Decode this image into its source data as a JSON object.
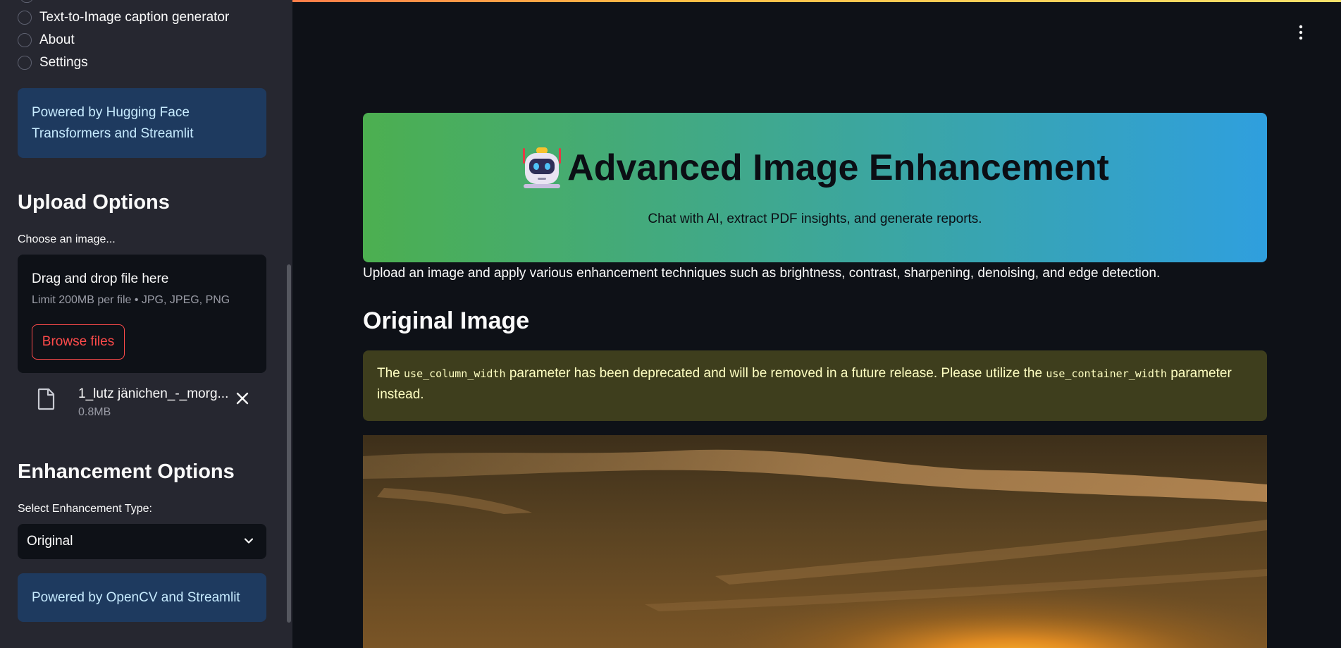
{
  "sidebar": {
    "nav": {
      "items": [
        "Text-to-Image caption generator",
        "About",
        "Settings"
      ]
    },
    "info_top": "Powered by Hugging Face Transformers and Streamlit",
    "upload": {
      "heading": "Upload Options",
      "label": "Choose an image...",
      "drop_title": "Drag and drop file here",
      "drop_limit": "Limit 200MB per file • JPG, JPEG, PNG",
      "browse_label": "Browse files",
      "file_name": "1_lutz jänichen_-_morg...",
      "file_size": "0.8MB"
    },
    "enhancement": {
      "heading": "Enhancement Options",
      "label": "Select Enhancement Type:",
      "selected": "Original"
    },
    "info_bottom": "Powered by OpenCV and Streamlit"
  },
  "main": {
    "hero": {
      "title": "Advanced Image Enhancement",
      "subtitle": "Chat with AI, extract PDF insights, and generate reports."
    },
    "intro": "Upload an image and apply various enhancement techniques such as brightness, contrast, sharpening, denoising, and edge detection.",
    "original_heading": "Original Image",
    "warning": {
      "pre": "The",
      "code1": "use_column_width",
      "mid": "parameter has been deprecated and will be removed in a future release. Please utilize the",
      "code2": "use_container_width",
      "post": "parameter instead."
    }
  },
  "icons": {
    "menu": "vertical-dots-icon",
    "file": "file-icon",
    "remove": "close-icon",
    "dropdown": "chevron-down-icon",
    "hero": "robot-emoji-icon"
  },
  "colors": {
    "accent": "#ff4b4b",
    "info_bg": "#1e3a5f",
    "warning_bg": "#3e3e1d",
    "hero_gradient_start": "#4caf50",
    "hero_gradient_end": "#2f9fde"
  }
}
